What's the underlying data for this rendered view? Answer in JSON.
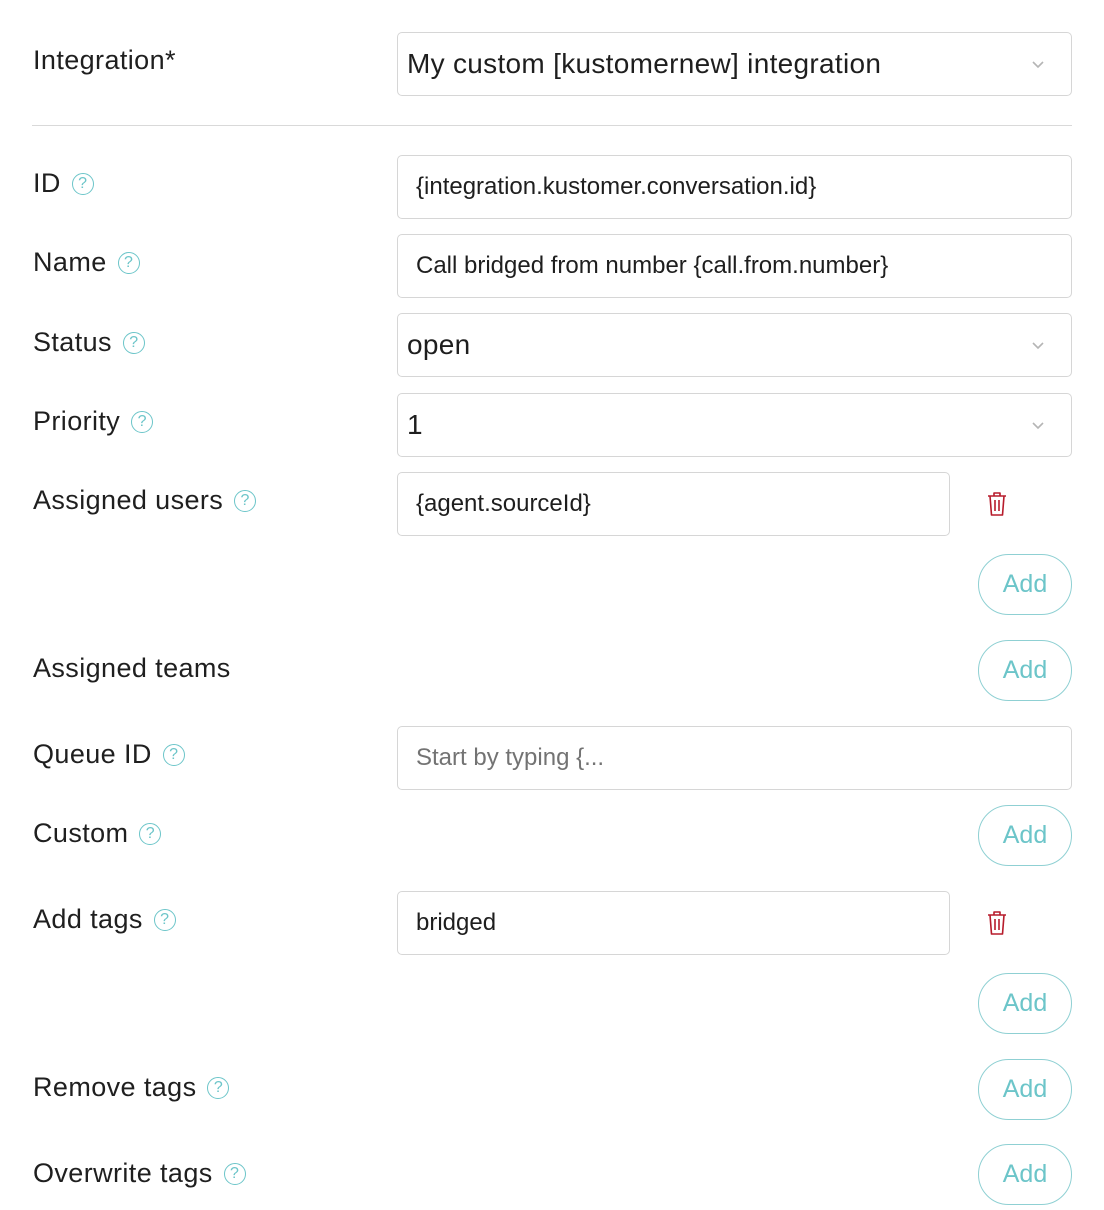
{
  "integration": {
    "label": "Integration*",
    "value": "My custom [kustomernew] integration"
  },
  "fields": {
    "id": {
      "label": "ID",
      "value": "{integration.kustomer.conversation.id}"
    },
    "name": {
      "label": "Name",
      "value": "Call bridged from number {call.from.number}"
    },
    "status": {
      "label": "Status",
      "value": "open"
    },
    "priority": {
      "label": "Priority",
      "value": "1"
    },
    "assigned_users": {
      "label": "Assigned users",
      "value": "{agent.sourceId}"
    },
    "assigned_teams": {
      "label": "Assigned teams"
    },
    "queue_id": {
      "label": "Queue ID",
      "placeholder": "Start by typing {..."
    },
    "custom": {
      "label": "Custom"
    },
    "add_tags": {
      "label": "Add tags",
      "value": "bridged"
    },
    "remove_tags": {
      "label": "Remove tags"
    },
    "overwrite_tags": {
      "label": "Overwrite tags"
    }
  },
  "help_glyph": "?",
  "add_label": "Add",
  "colors": {
    "accent": "#6cc5c9",
    "delete": "#b71c2c",
    "border": "#d6d6d6"
  },
  "icons": {
    "help": "question-circle-icon",
    "dropdown": "chevron-down-icon",
    "delete": "trash-icon"
  }
}
